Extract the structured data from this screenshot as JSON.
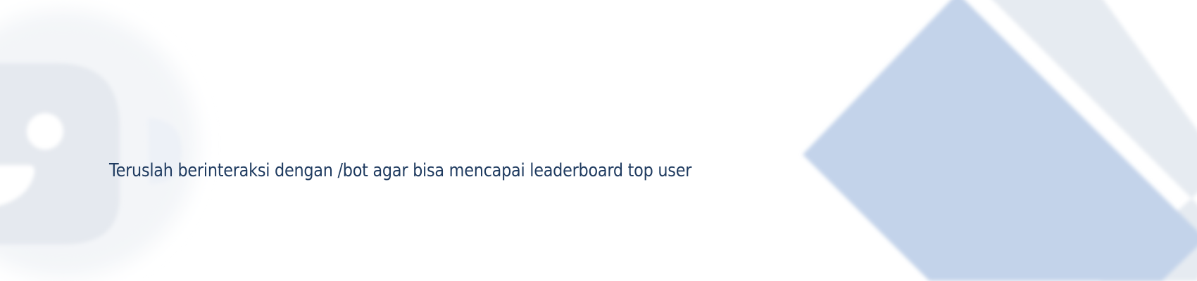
{
  "banner": {
    "message": "Teruslah berinteraksi dengan /bot agar bisa mencapai leaderboard top user"
  },
  "colors": {
    "background": "#ffffff",
    "text": "#1e3a5f",
    "diamond": "#c3d3ea",
    "diamond_edge": "#e6ebf1",
    "icon_shape": "#e5e9ef",
    "icon_glow": "#f3f5f8"
  },
  "decorations": {
    "left_icon": "blurred-chat-bubble-icon",
    "right_shape": "diamond-shape"
  }
}
